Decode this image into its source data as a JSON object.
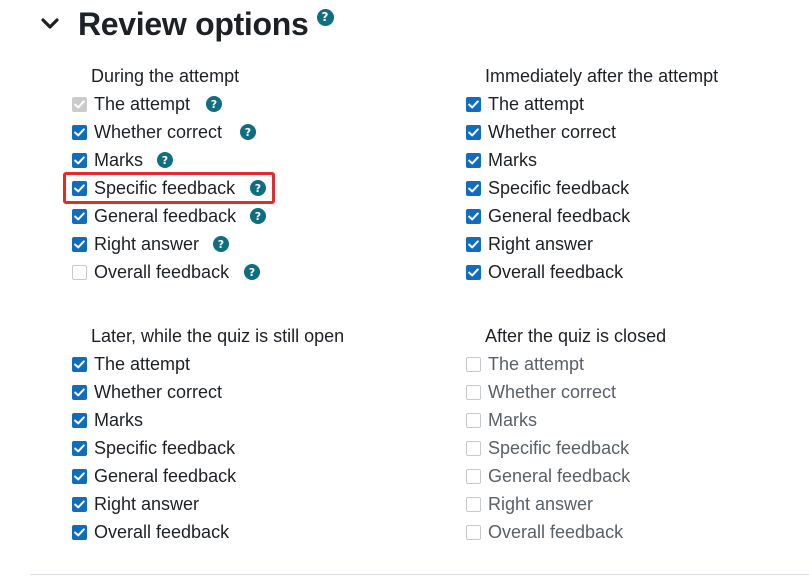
{
  "section": {
    "title": "Review options",
    "help_icon": "?"
  },
  "columns": [
    {
      "heading": "During the attempt",
      "items": [
        {
          "label": "The attempt",
          "checked": true,
          "disabled": true,
          "help": true
        },
        {
          "label": "Whether correct",
          "checked": true,
          "help": true
        },
        {
          "label": "Marks",
          "checked": true,
          "help": true
        },
        {
          "label": "Specific feedback",
          "checked": true,
          "help": true,
          "highlighted": true
        },
        {
          "label": "General feedback",
          "checked": true,
          "help": true
        },
        {
          "label": "Right answer",
          "checked": true,
          "help": true
        },
        {
          "label": "Overall feedback",
          "checked": false,
          "help": true
        }
      ]
    },
    {
      "heading": "Immediately after the attempt",
      "items": [
        {
          "label": "The attempt",
          "checked": true
        },
        {
          "label": "Whether correct",
          "checked": true
        },
        {
          "label": "Marks",
          "checked": true
        },
        {
          "label": "Specific feedback",
          "checked": true
        },
        {
          "label": "General feedback",
          "checked": true
        },
        {
          "label": "Right answer",
          "checked": true
        },
        {
          "label": "Overall feedback",
          "checked": true
        }
      ]
    },
    {
      "heading": "Later, while the quiz is still open",
      "items": [
        {
          "label": "The attempt",
          "checked": true
        },
        {
          "label": "Whether correct",
          "checked": true
        },
        {
          "label": "Marks",
          "checked": true
        },
        {
          "label": "Specific feedback",
          "checked": true
        },
        {
          "label": "General feedback",
          "checked": true
        },
        {
          "label": "Right answer",
          "checked": true
        },
        {
          "label": "Overall feedback",
          "checked": true
        }
      ]
    },
    {
      "heading": "After the quiz is closed",
      "items": [
        {
          "label": "The attempt",
          "checked": false
        },
        {
          "label": "Whether correct",
          "checked": false
        },
        {
          "label": "Marks",
          "checked": false
        },
        {
          "label": "Specific feedback",
          "checked": false
        },
        {
          "label": "General feedback",
          "checked": false
        },
        {
          "label": "Right answer",
          "checked": false
        },
        {
          "label": "Overall feedback",
          "checked": false
        }
      ]
    }
  ],
  "colors": {
    "checkbox_checked": "#0f6cbf",
    "help_icon": "#0f6e7f",
    "highlight": "#e22b2b"
  }
}
